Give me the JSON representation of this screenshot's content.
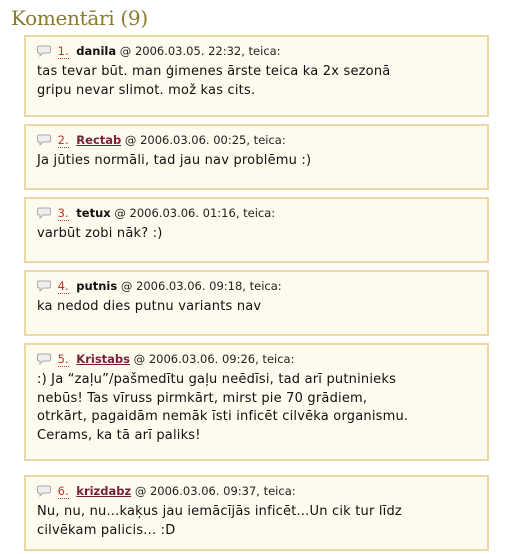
{
  "heading": "Komentāri (9)",
  "comments": [
    {
      "num": "1.",
      "author": "danila",
      "sep": "@",
      "timestamp": "2006.03.05. 22:32",
      "said": ", teica:",
      "lines": [
        "tas tevar būt. man ģimenes ārste teica ka 2x sezonā",
        "gripu nevar slimot. mož kas cits."
      ]
    },
    {
      "num": "2.",
      "author": "Rectab",
      "sep": "@",
      "timestamp": "2006.03.06. 00:25",
      "said": ", teica:",
      "lines": [
        "Ja jūties normāli, tad jau nav problēmu :)"
      ]
    },
    {
      "num": "3.",
      "author": "tetux",
      "sep": "@",
      "timestamp": "2006.03.06. 01:16",
      "said": ", teica:",
      "lines": [
        "varbūt zobi nāk? :)"
      ]
    },
    {
      "num": "4.",
      "author": "putnis",
      "sep": "@",
      "timestamp": "2006.03.06. 09:18",
      "said": ", teica:",
      "lines": [
        "ka nedod dies putnu variants nav"
      ]
    },
    {
      "num": "5.",
      "author": "Kristabs",
      "sep": "@",
      "timestamp": "2006.03.06. 09:26",
      "said": ", teica:",
      "lines": [
        ":) Ja “zaļu”/pašmedītu gaļu neēdīsi, tad arī putninieks",
        "nebūs! Tas vīruss pirmkārt, mirst pie 70 grādiem,",
        "otrkārt, pagaidām nemāk īsti inficēt cilvēka organismu.",
        "Cerams, ka tā arī paliks!"
      ]
    },
    {
      "num": "6.",
      "author": "krizdabz",
      "sep": "@",
      "timestamp": "2006.03.06. 09:37",
      "said": ", teica:",
      "lines": [
        "Nu, nu, nu...kaķus jau iemācījās inficēt...Un cik tur līdz",
        "cilvēkam palicis... :D"
      ]
    }
  ]
}
